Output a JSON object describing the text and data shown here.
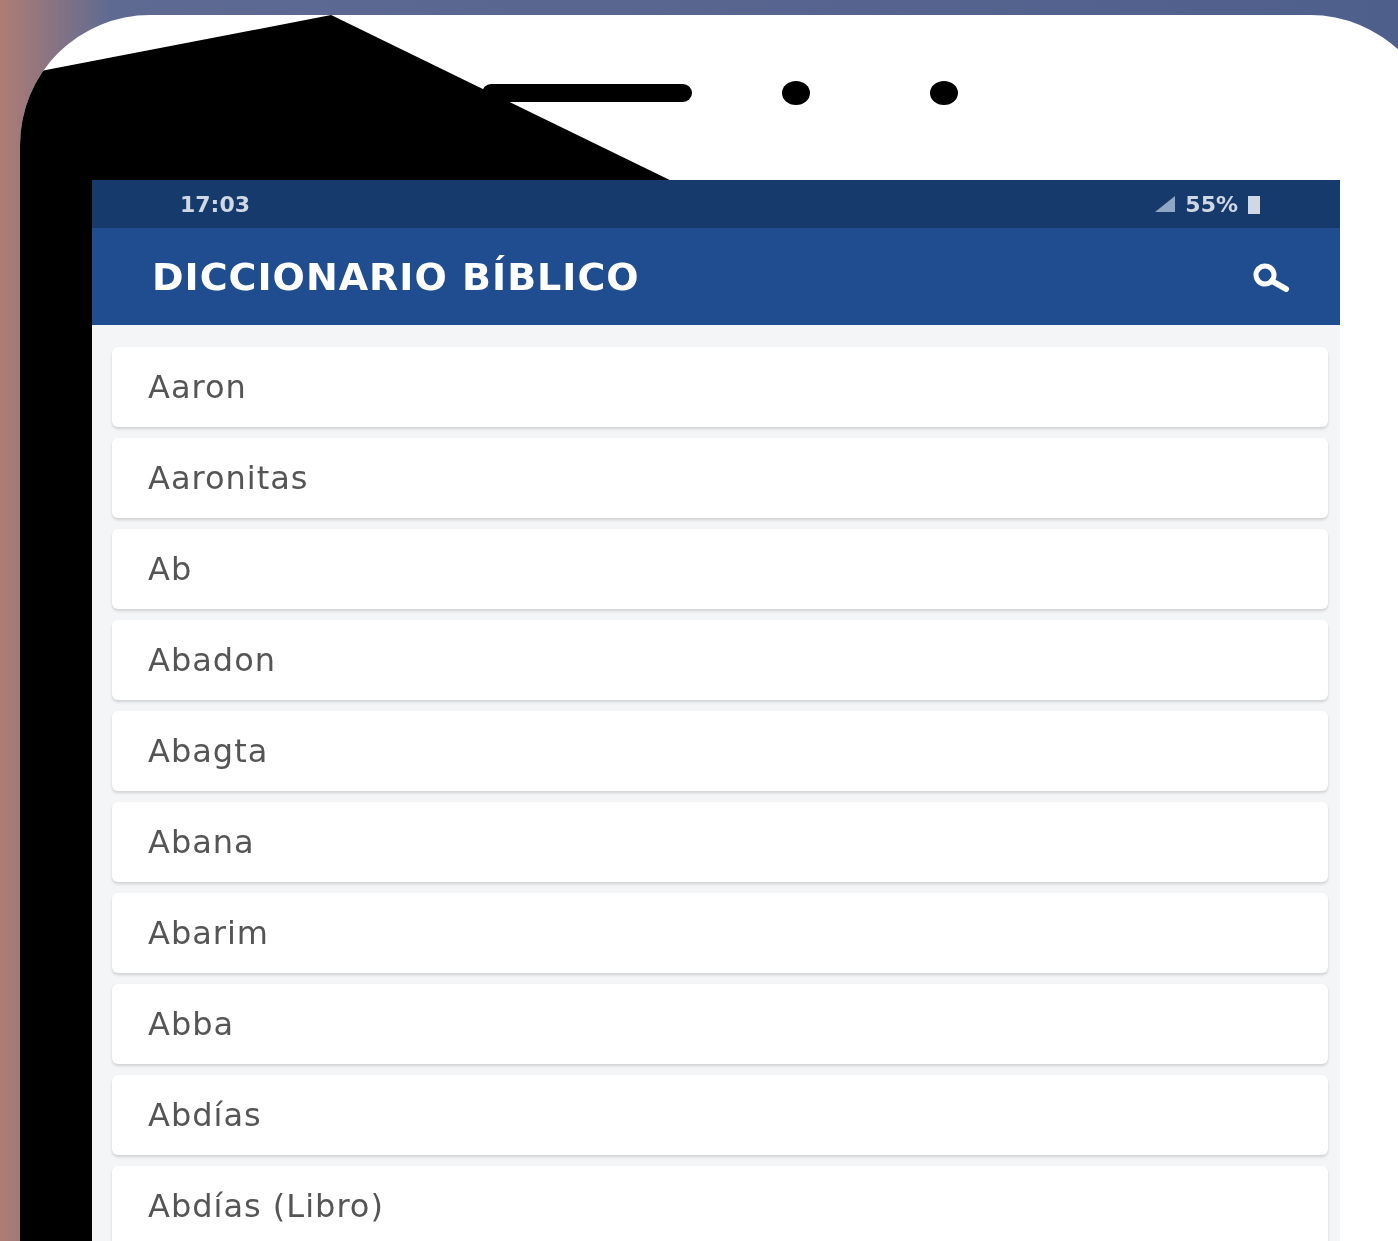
{
  "status_bar": {
    "time": "17:03",
    "battery": "55%"
  },
  "app_bar": {
    "title": "DICCIONARIO BÍBLICO"
  },
  "entries": [
    {
      "name": "Aaron"
    },
    {
      "name": "Aaronitas"
    },
    {
      "name": "Ab"
    },
    {
      "name": "Abadon"
    },
    {
      "name": "Abagta"
    },
    {
      "name": "Abana"
    },
    {
      "name": "Abarim"
    },
    {
      "name": "Abba"
    },
    {
      "name": "Abdías"
    },
    {
      "name": "Abdías (Libro)"
    }
  ]
}
